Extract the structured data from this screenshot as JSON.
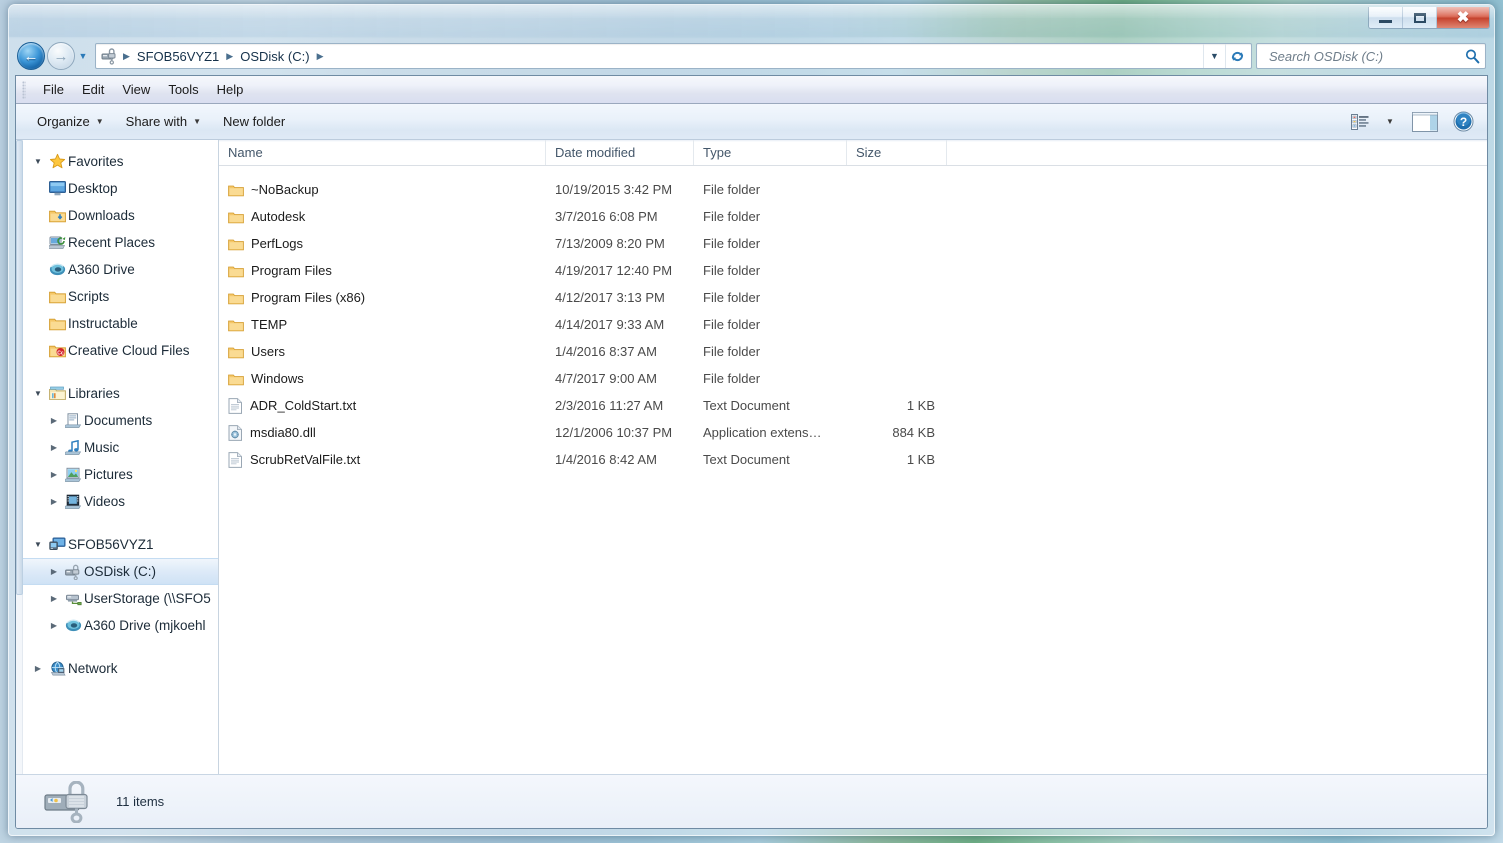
{
  "window": {
    "controls": {
      "minimize": "Minimize",
      "maximize": "Maximize",
      "close": "Close"
    }
  },
  "navigation": {
    "back_label": "Back",
    "forward_label": "Forward",
    "history_label": "Recent pages",
    "refresh_label": "Refresh",
    "address_dropdown_label": "Previous locations",
    "breadcrumbs": [
      "SFOB56VYZ1",
      "OSDisk (C:)"
    ]
  },
  "search": {
    "placeholder": "Search OSDisk (C:)",
    "value": ""
  },
  "menubar": {
    "items": [
      "File",
      "Edit",
      "View",
      "Tools",
      "Help"
    ]
  },
  "toolbar": {
    "organize": "Organize",
    "share_with": "Share with",
    "new_folder": "New folder",
    "view_icon": "view-list-icon",
    "view_caret": "chevron-down-icon",
    "preview_pane_icon": "preview-pane-icon",
    "help_icon": "help-icon"
  },
  "sidebar": {
    "groups": [
      {
        "name": "Favorites",
        "icon": "star-icon",
        "expander": "expanded",
        "items": [
          {
            "label": "Desktop",
            "icon": "desktop-icon",
            "expander": "none"
          },
          {
            "label": "Downloads",
            "icon": "downloads-folder-icon",
            "expander": "none"
          },
          {
            "label": "Recent Places",
            "icon": "recent-places-icon",
            "expander": "none"
          },
          {
            "label": "A360 Drive",
            "icon": "a360-drive-icon",
            "expander": "none"
          },
          {
            "label": "Scripts",
            "icon": "folder-icon",
            "expander": "none"
          },
          {
            "label": "Instructable",
            "icon": "folder-icon",
            "expander": "none"
          },
          {
            "label": "Creative Cloud Files",
            "icon": "creative-cloud-folder-icon",
            "expander": "none"
          }
        ]
      },
      {
        "name": "Libraries",
        "icon": "libraries-icon",
        "expander": "expanded",
        "items": [
          {
            "label": "Documents",
            "icon": "documents-library-icon",
            "expander": "collapsed"
          },
          {
            "label": "Music",
            "icon": "music-library-icon",
            "expander": "collapsed"
          },
          {
            "label": "Pictures",
            "icon": "pictures-library-icon",
            "expander": "collapsed"
          },
          {
            "label": "Videos",
            "icon": "videos-library-icon",
            "expander": "collapsed"
          }
        ]
      },
      {
        "name": "SFOB56VYZ1",
        "icon": "computer-icon",
        "expander": "expanded",
        "items": [
          {
            "label": "OSDisk (C:)",
            "icon": "bitlocker-drive-icon",
            "expander": "collapsed",
            "selected": true
          },
          {
            "label": "UserStorage (\\\\SFO5",
            "icon": "network-drive-icon",
            "expander": "collapsed"
          },
          {
            "label": "A360 Drive (mjkoehl",
            "icon": "a360-drive-icon",
            "expander": "collapsed"
          }
        ]
      },
      {
        "name": "Network",
        "icon": "network-icon",
        "expander": "collapsed",
        "items": []
      }
    ]
  },
  "filelist": {
    "columns": [
      "Name",
      "Date modified",
      "Type",
      "Size"
    ],
    "sorted_by": "Name",
    "sort_direction": "ascending",
    "rows": [
      {
        "name": "~NoBackup",
        "date": "10/19/2015 3:42 PM",
        "type": "File folder",
        "size": "",
        "icon": "folder-icon"
      },
      {
        "name": "Autodesk",
        "date": "3/7/2016 6:08 PM",
        "type": "File folder",
        "size": "",
        "icon": "folder-icon"
      },
      {
        "name": "PerfLogs",
        "date": "7/13/2009 8:20 PM",
        "type": "File folder",
        "size": "",
        "icon": "folder-icon"
      },
      {
        "name": "Program Files",
        "date": "4/19/2017 12:40 PM",
        "type": "File folder",
        "size": "",
        "icon": "folder-icon"
      },
      {
        "name": "Program Files (x86)",
        "date": "4/12/2017 3:13 PM",
        "type": "File folder",
        "size": "",
        "icon": "folder-icon"
      },
      {
        "name": "TEMP",
        "date": "4/14/2017 9:33 AM",
        "type": "File folder",
        "size": "",
        "icon": "folder-icon"
      },
      {
        "name": "Users",
        "date": "1/4/2016 8:37 AM",
        "type": "File folder",
        "size": "",
        "icon": "folder-icon"
      },
      {
        "name": "Windows",
        "date": "4/7/2017 9:00 AM",
        "type": "File folder",
        "size": "",
        "icon": "folder-icon"
      },
      {
        "name": "ADR_ColdStart.txt",
        "date": "2/3/2016 11:27 AM",
        "type": "Text Document",
        "size": "1 KB",
        "icon": "text-document-icon"
      },
      {
        "name": "msdia80.dll",
        "date": "12/1/2006 10:37 PM",
        "type": "Application extens…",
        "size": "884 KB",
        "icon": "dll-icon"
      },
      {
        "name": "ScrubRetValFile.txt",
        "date": "1/4/2016 8:42 AM",
        "type": "Text Document",
        "size": "1 KB",
        "icon": "text-document-icon"
      }
    ]
  },
  "statusbar": {
    "item_count": "11 items",
    "icon": "bitlocker-drive-icon"
  },
  "colors": {
    "selection": "#cfe2f5",
    "accent": "#2b7ab8",
    "folder_yellow": "#f7c96b",
    "close_red": "#c5412c"
  }
}
